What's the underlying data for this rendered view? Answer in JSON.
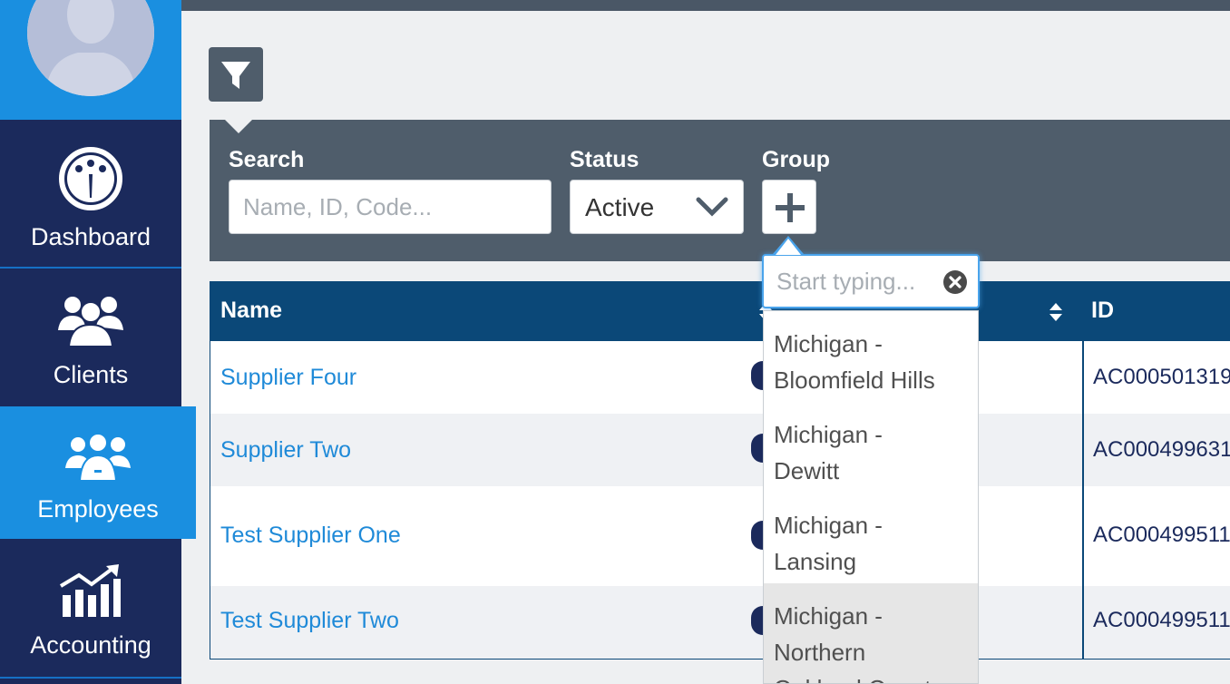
{
  "sidebar": {
    "items": [
      {
        "label": "Dashboard",
        "icon": "dashboard-gauge-icon"
      },
      {
        "label": "Clients",
        "icon": "clients-group-icon"
      },
      {
        "label": "Employees",
        "icon": "employees-team-icon",
        "active": true
      },
      {
        "label": "Accounting",
        "icon": "accounting-chart-icon"
      }
    ]
  },
  "filters": {
    "search_label": "Search",
    "search_placeholder": "Name, ID, Code...",
    "status_label": "Status",
    "status_value": "Active",
    "group_label": "Group"
  },
  "group_dropdown": {
    "placeholder": "Start typing...",
    "options": [
      {
        "line1": "Michigan -",
        "line2": "Bloomfield Hills"
      },
      {
        "line1": "Michigan -",
        "line2": "Dewitt"
      },
      {
        "line1": "Michigan -",
        "line2": "Lansing"
      },
      {
        "line1": "Michigan -",
        "line2": "Northern",
        "line3": "Oakland County",
        "highlighted": true
      }
    ]
  },
  "table": {
    "headers": {
      "name": "Name",
      "id": "ID"
    },
    "rows": [
      {
        "name": "Supplier Four",
        "id": "AC000501319"
      },
      {
        "name": "Supplier Two",
        "id": "AC000499631"
      },
      {
        "name": "Test Supplier One",
        "id": "AC000499511"
      },
      {
        "name": "Test Supplier Two",
        "id": "AC000499511"
      }
    ]
  },
  "colors": {
    "sidebar_bg": "#1b2a5c",
    "accent_blue": "#1a8fe0",
    "table_header": "#0b4878",
    "filter_panel": "#4f5d6b",
    "link": "#1f8ad8"
  }
}
